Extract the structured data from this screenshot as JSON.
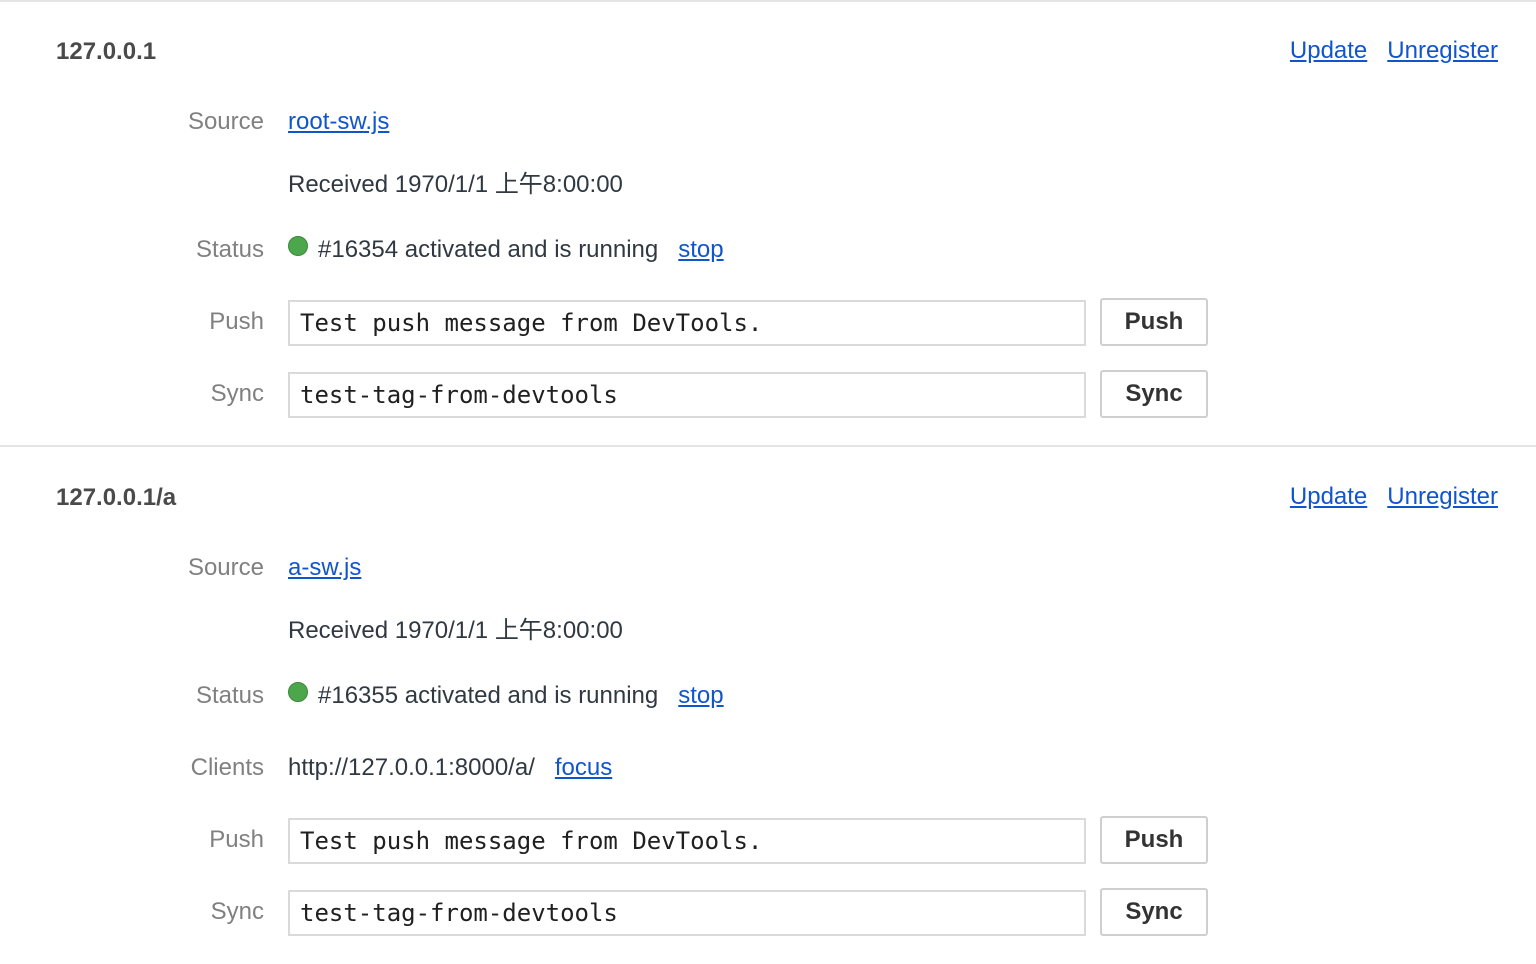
{
  "registrations": [
    {
      "scope": "127.0.0.1",
      "update_label": "Update",
      "unregister_label": "Unregister",
      "source_label": "Source",
      "source_link": "root-sw.js",
      "received": "Received 1970/1/1 上午8:00:00",
      "status_label": "Status",
      "status_text": "#16354 activated and is running",
      "status_color": "#4ca64c",
      "stop_label": "stop",
      "push_label": "Push",
      "push_value": "Test push message from DevTools.",
      "push_button": "Push",
      "sync_label": "Sync",
      "sync_value": "test-tag-from-devtools",
      "sync_button": "Sync"
    },
    {
      "scope": "127.0.0.1/a",
      "update_label": "Update",
      "unregister_label": "Unregister",
      "source_label": "Source",
      "source_link": "a-sw.js",
      "received": "Received 1970/1/1 上午8:00:00",
      "status_label": "Status",
      "status_text": "#16355 activated and is running",
      "status_color": "#4ca64c",
      "stop_label": "stop",
      "clients_label": "Clients",
      "client_url": "http://127.0.0.1:8000/a/",
      "focus_label": "focus",
      "push_label": "Push",
      "push_value": "Test push message from DevTools.",
      "push_button": "Push",
      "sync_label": "Sync",
      "sync_value": "test-tag-from-devtools",
      "sync_button": "Sync"
    }
  ]
}
